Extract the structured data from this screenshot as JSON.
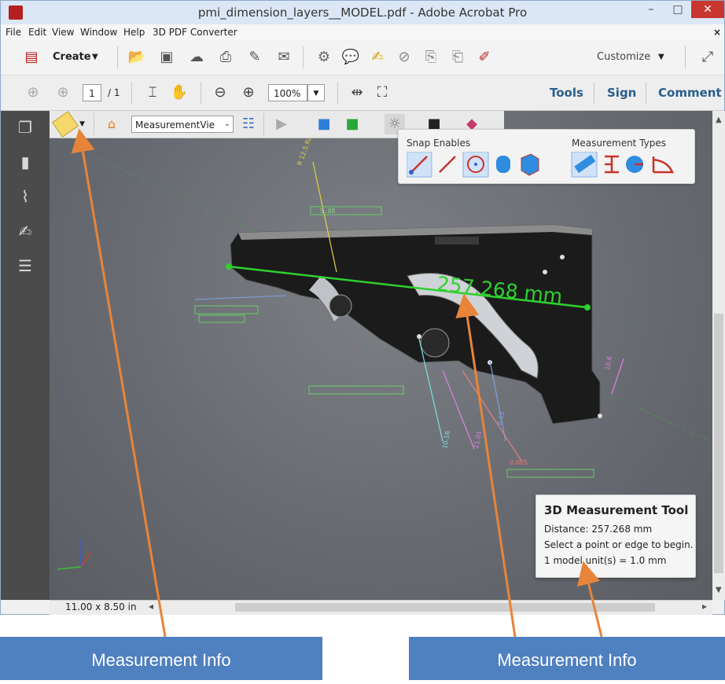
{
  "window": {
    "title": "pmi_dimension_layers__MODEL.pdf - Adobe Acrobat Pro",
    "minimize": "–",
    "maximize": "□",
    "close": "✕"
  },
  "menu": [
    "File",
    "Edit",
    "View",
    "Window",
    "Help",
    "3D PDF Converter"
  ],
  "menu_close": "×",
  "toolbar1": {
    "create_label": "Create",
    "customize_label": "Customize"
  },
  "toolbar2": {
    "page_number": "1",
    "page_total": "/ 1",
    "zoom": "100%",
    "tools": "Tools",
    "sign": "Sign",
    "comment": "Comment"
  },
  "toolbar3d": {
    "view_select": "MeasurementVie"
  },
  "snap_panel": {
    "snap_title": "Snap Enables",
    "types_title": "Measurement Types"
  },
  "model": {
    "distance_label": "257.268 mm",
    "dim_small": "5.08",
    "radius_note": "R 12.5 Radius to Center",
    "pmi_values": [
      "10.16",
      "21.01",
      "6.12",
      "0.005",
      "10.6"
    ]
  },
  "infobox": {
    "title": "3D Measurement Tool",
    "line1": "Distance:  257.268 mm",
    "line2": "Select a point or edge to begin.",
    "line3": "1 model unit(s) = 1.0 mm"
  },
  "statusbar": {
    "page_size": "11.00 x 8.50 in"
  },
  "callouts": {
    "left": "Measurement Info",
    "right": "Measurement Info"
  },
  "colors": {
    "accent_orange": "#e8843a",
    "measure_green": "#2fd02f",
    "callout_blue": "#4f80c0",
    "close_red": "#c7372f"
  }
}
